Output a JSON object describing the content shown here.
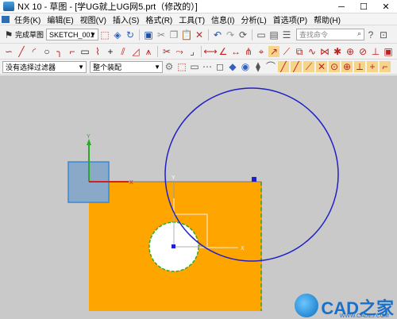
{
  "window": {
    "title": "NX 10 - 草图 - [学UG就上UG网5.prt（修改的）]"
  },
  "menubar": {
    "items": [
      {
        "name": "menu-task",
        "label": "任务(K)"
      },
      {
        "name": "menu-edit",
        "label": "编辑(E)"
      },
      {
        "name": "menu-view",
        "label": "视图(V)"
      },
      {
        "name": "menu-insert",
        "label": "插入(S)"
      },
      {
        "name": "menu-format",
        "label": "格式(R)"
      },
      {
        "name": "menu-tools",
        "label": "工具(T)"
      },
      {
        "name": "menu-info",
        "label": "信息(I)"
      },
      {
        "name": "menu-analysis",
        "label": "分析(L)"
      },
      {
        "name": "menu-prefs",
        "label": "首选项(P)"
      },
      {
        "name": "menu-help",
        "label": "帮助(H)"
      }
    ]
  },
  "toolbar": {
    "finish_sketch": "完成草图",
    "sketch_name": "SKETCH_001",
    "search_placeholder": "查找命令",
    "selection_filter": "没有选择过滤器",
    "assembly_scope": "整个装配"
  },
  "watermark": {
    "brand": "CAD之家",
    "url": "WWW.CADZJ.COM"
  },
  "colors": {
    "sheet": "#ffa500",
    "circle_large": "#2020c8",
    "circle_small": "#ffffff",
    "axis_x": "#d02020",
    "axis_y": "#20a020",
    "triad_box": "#6e9ed6"
  }
}
